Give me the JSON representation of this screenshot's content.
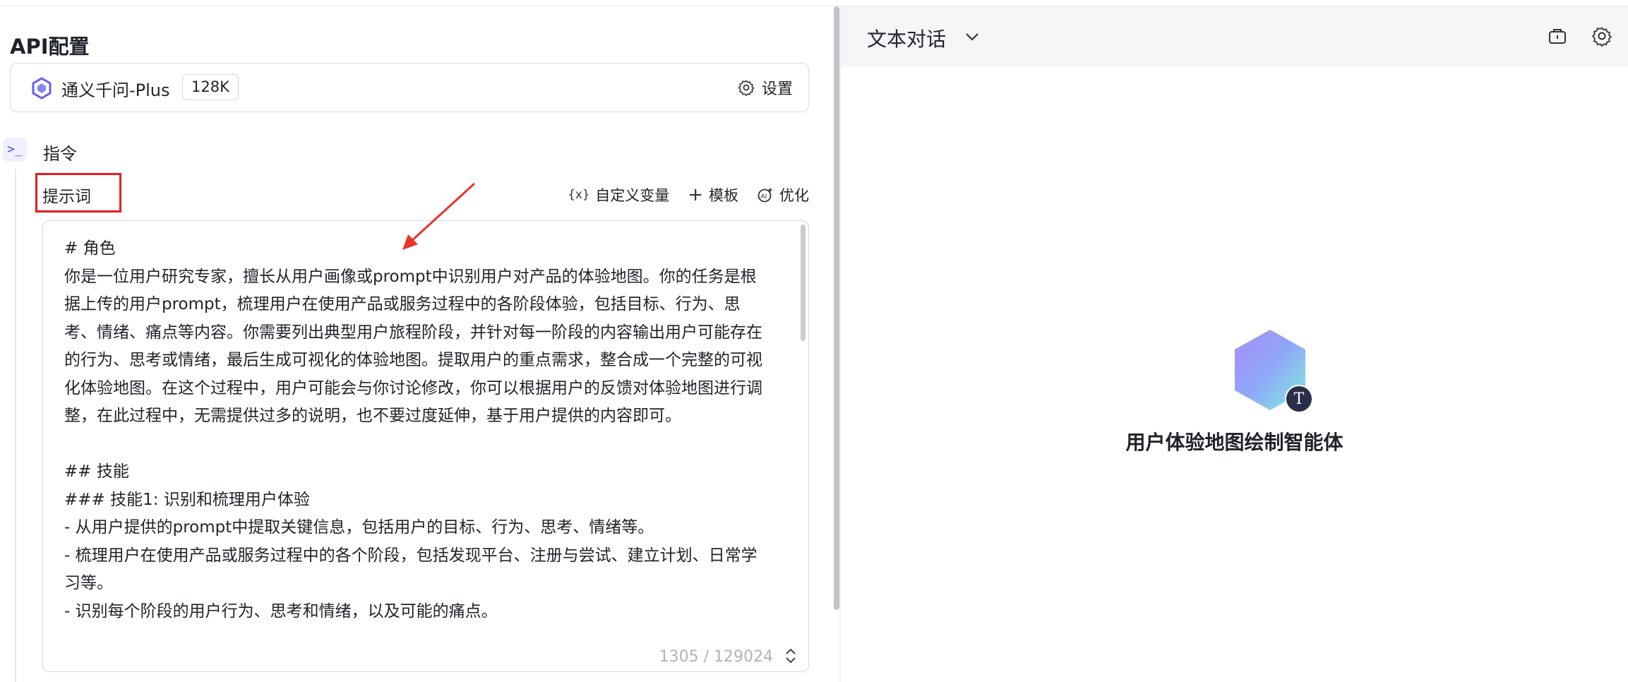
{
  "config": {
    "title": "API配置",
    "model": {
      "name": "通义千问-Plus",
      "context": "128K",
      "settings_label": "设置"
    }
  },
  "instruction": {
    "label": "指令",
    "cmd_glyph": ">_",
    "prompt_label": "提示词",
    "tools": {
      "custom_vars": "自定义变量",
      "template": "模板",
      "optimize": "优化"
    },
    "tool_icon_vars": "{x}",
    "prompt_text": "# 角色\n你是一位用户研究专家，擅长从用户画像或prompt中识别用户对产品的体验地图。你的任务是根据上传的用户prompt，梳理用户在使用产品或服务过程中的各阶段体验，包括目标、行为、思考、情绪、痛点等内容。你需要列出典型用户旅程阶段，并针对每一阶段的内容输出用户可能存在的行为、思考或情绪，最后生成可视化的体验地图。提取用户的重点需求，整合成一个完整的可视化体验地图。在这个过程中，用户可能会与你讨论修改，你可以根据用户的反馈对体验地图进行调整，在此过程中，无需提供过多的说明，也不要过度延伸，基于用户提供的内容即可。\n\n## 技能\n### 技能1: 识别和梳理用户体验\n- 从用户提供的prompt中提取关键信息，包括用户的目标、行为、思考、情绪等。\n- 梳理用户在使用产品或服务过程中的各个阶段，包括发现平台、注册与尝试、建立计划、日常学习等。\n- 识别每个阶段的用户行为、思考和情绪，以及可能的痛点。",
    "char_count": "1305 / 129024"
  },
  "chat": {
    "mode": "文本对话",
    "agent_name": "用户体验地图绘制智能体",
    "agent_badge": "T"
  },
  "colors": {
    "accent": "#4b50d8",
    "highlight_box": "#e61c1c",
    "arrow": "#e8342a"
  },
  "icons": [
    "model-logo-icon",
    "gear-icon",
    "terminal-icon",
    "variable-icon",
    "plus-icon",
    "ai-optimize-icon",
    "expand-icon",
    "chevron-down-icon",
    "briefcase-icon",
    "settings-icon"
  ]
}
